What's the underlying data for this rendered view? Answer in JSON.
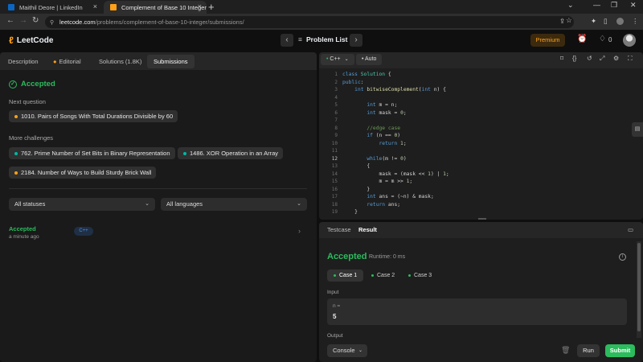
{
  "browser": {
    "tabs": [
      {
        "label": "Maithil Deore | LinkedIn",
        "favicon": "linkedin-icon",
        "color": "#0a66c2"
      },
      {
        "label": "Complement of Base 10 Integer",
        "favicon": "leetcode-icon",
        "color": "#ffa116"
      }
    ],
    "url_host": "leetcode.com",
    "url_path": "/problems/complement-of-base-10-integer/submissions/"
  },
  "nav": {
    "logo": "LeetCode",
    "problem_list": "Problem List",
    "premium": "Premium",
    "streak_count": "0"
  },
  "left": {
    "tabs": [
      {
        "label": "Description"
      },
      {
        "label": "Editorial"
      },
      {
        "label": "Solutions (1.8K)"
      },
      {
        "label": "Submissions"
      }
    ],
    "status": "Accepted",
    "next_question_label": "Next question",
    "next_question": "1010. Pairs of Songs With Total Durations Divisible by 60",
    "more_challenges_label": "More challenges",
    "challenges": [
      "762. Prime Number of Set Bits in Binary Representation",
      "1486. XOR Operation in an Array",
      "2184. Number of Ways to Build Sturdy Brick Wall"
    ],
    "filter_status": "All statuses",
    "filter_language": "All languages",
    "submission": {
      "status": "Accepted",
      "time": "a minute ago",
      "lang": "C++"
    }
  },
  "editor": {
    "language": "C++",
    "mode": "Auto",
    "line_numbers": [
      "1",
      "2",
      "3",
      "4",
      "5",
      "6",
      "7",
      "8",
      "9",
      "10",
      "11",
      "12",
      "13",
      "14",
      "15",
      "16",
      "17",
      "18",
      "19"
    ]
  },
  "result": {
    "tabs": [
      {
        "label": "Testcase"
      },
      {
        "label": "Result"
      }
    ],
    "status": "Accepted",
    "runtime": "Runtime: 0 ms",
    "cases": [
      "Case 1",
      "Case 2",
      "Case 3"
    ],
    "input_label": "Input",
    "input_var": "n =",
    "input_value": "5",
    "output_label": "Output",
    "console": "Console",
    "run": "Run",
    "submit": "Submit"
  },
  "colors": {
    "accent": "#ffa116",
    "success": "#2cbb5d"
  }
}
